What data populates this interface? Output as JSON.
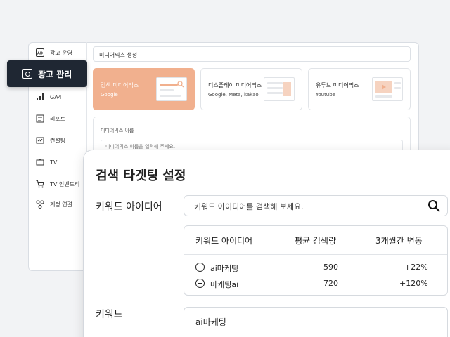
{
  "sidebar": {
    "items": [
      {
        "label": "광고 운영",
        "icon": "ad-icon"
      },
      {
        "label": "광고 관리",
        "icon": "gear-icon",
        "active": true
      },
      {
        "label": "GA4",
        "icon": "bar-chart-icon"
      },
      {
        "label": "리포트",
        "icon": "report-icon"
      },
      {
        "label": "컨설팅",
        "icon": "consulting-icon"
      },
      {
        "label": "TV",
        "icon": "tv-icon"
      },
      {
        "label": "TV 인벤토리",
        "icon": "cart-icon"
      },
      {
        "label": "계정 연결",
        "icon": "link-icon"
      }
    ]
  },
  "header": {
    "title": "미디어믹스 생성"
  },
  "cards": [
    {
      "title": "검색 미디어믹스",
      "subtitle": "Google"
    },
    {
      "title": "디스플레이 미디어믹스",
      "subtitle": "Google, Meta, kakao"
    },
    {
      "title": "유투브 미디어믹스",
      "subtitle": "Youtube"
    }
  ],
  "name_section": {
    "label": "미디어믹스 이름",
    "placeholder": "미디어믹스 이름을 입력해 주세요."
  },
  "panel": {
    "title": "검색 타겟팅 설정",
    "keyword_idea_label": "키워드 아이디어",
    "search_placeholder": "키워드 아이디어를 검색해 보세요.",
    "table": {
      "headers": [
        "키워드 아이디어",
        "평균 검색량",
        "3개월간 변동"
      ],
      "rows": [
        {
          "keyword": "ai마케팅",
          "volume": "590",
          "change": "+22%"
        },
        {
          "keyword": "마케팅ai",
          "volume": "720",
          "change": "+120%"
        }
      ]
    },
    "keyword_label": "키워드",
    "keyword_value": "ai마케팅"
  },
  "colors": {
    "accent": "#f1b08e",
    "active_nav": "#1f2733"
  }
}
